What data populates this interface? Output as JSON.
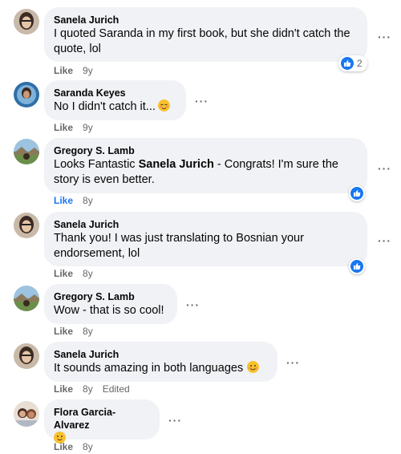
{
  "comments": [
    {
      "author": "Sanela Jurich",
      "text": "I quoted Saranda in my first book, but she didn't catch the quote, lol",
      "like_label": "Like",
      "time": "9y",
      "reaction_count": "2"
    },
    {
      "author": "Saranda Keyes",
      "text": "No I didn't catch it...",
      "emoji": "relieved-face-emoji",
      "like_label": "Like",
      "time": "9y"
    },
    {
      "author": "Gregory S. Lamb",
      "text_before": "Looks Fantastic ",
      "mention": "Sanela Jurich",
      "text_after": " - Congrats! I'm sure the story is even better.",
      "like_label": "Like",
      "time": "8y"
    },
    {
      "author": "Sanela Jurich",
      "text": "Thank you! I was just translating to Bosnian your endorsement, lol",
      "like_label": "Like",
      "time": "8y"
    },
    {
      "author": "Gregory S. Lamb",
      "text": "Wow - that is so cool!",
      "like_label": "Like",
      "time": "8y"
    },
    {
      "author": "Sanela Jurich",
      "text": "It sounds amazing in both languages",
      "emoji": "smiling-face-emoji",
      "like_label": "Like",
      "time": "8y",
      "edited": "Edited"
    },
    {
      "author": "Flora Garcia-Alvarez",
      "emoji": "slightly-smiling-face-emoji",
      "like_label": "Like",
      "time": "8y"
    }
  ],
  "colors": {
    "bubble": "#f0f2f5",
    "accent": "#1877f2",
    "meta": "#65676b"
  }
}
